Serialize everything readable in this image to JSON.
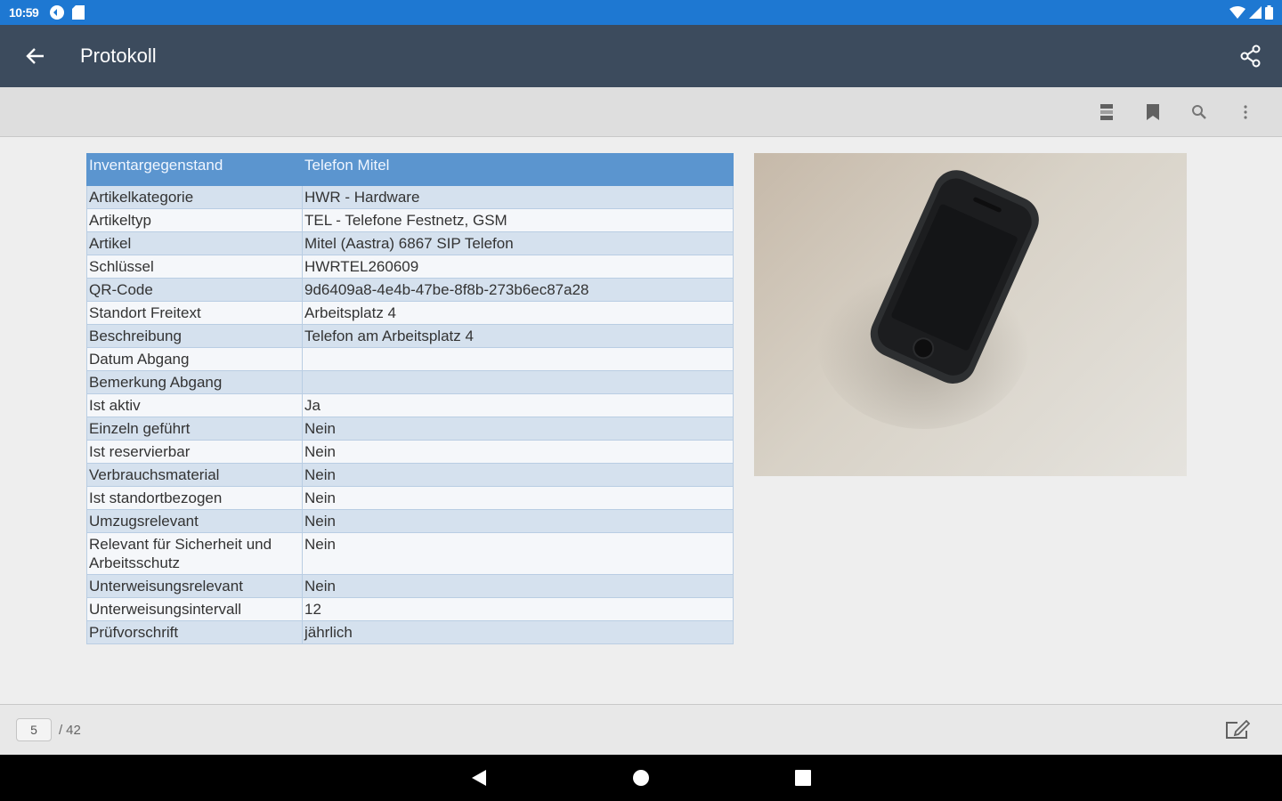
{
  "status_bar": {
    "time": "10:59"
  },
  "app_bar": {
    "title": "Protokoll"
  },
  "table": {
    "header": {
      "key": "Inventargegenstand",
      "value": "Telefon Mitel"
    },
    "rows": [
      {
        "key": "Artikelkategorie",
        "value": "HWR - Hardware"
      },
      {
        "key": "Artikeltyp",
        "value": "TEL - Telefone Festnetz, GSM"
      },
      {
        "key": "Artikel",
        "value": "Mitel (Aastra) 6867 SIP Telefon"
      },
      {
        "key": "Schlüssel",
        "value": "HWRTEL260609"
      },
      {
        "key": "QR-Code",
        "value": "9d6409a8-4e4b-47be-8f8b-273b6ec87a28"
      },
      {
        "key": "Standort Freitext",
        "value": "Arbeitsplatz 4"
      },
      {
        "key": "Beschreibung",
        "value": "Telefon am Arbeitsplatz 4"
      },
      {
        "key": "Datum Abgang",
        "value": ""
      },
      {
        "key": "Bemerkung Abgang",
        "value": ""
      },
      {
        "key": "Ist aktiv",
        "value": "Ja"
      },
      {
        "key": "Einzeln geführt",
        "value": "Nein"
      },
      {
        "key": "Ist reservierbar",
        "value": "Nein"
      },
      {
        "key": "Verbrauchsmaterial",
        "value": "Nein"
      },
      {
        "key": "Ist standortbezogen",
        "value": "Nein"
      },
      {
        "key": "Umzugsrelevant",
        "value": "Nein"
      },
      {
        "key": "Relevant für Sicherheit und Arbeitsschutz",
        "value": "Nein"
      },
      {
        "key": "Unterweisungsrelevant",
        "value": "Nein"
      },
      {
        "key": "Unterweisungsintervall",
        "value": "12"
      },
      {
        "key": "Prüfvorschrift",
        "value": "jährlich"
      }
    ]
  },
  "pager": {
    "current_page": "5",
    "separator": "/",
    "total_pages": "42"
  },
  "colors": {
    "status_bar": "#1e78d2",
    "app_bar": "#3c4b5d",
    "table_header": "#5b95cf",
    "table_row_alt": "#d5e1ee"
  }
}
